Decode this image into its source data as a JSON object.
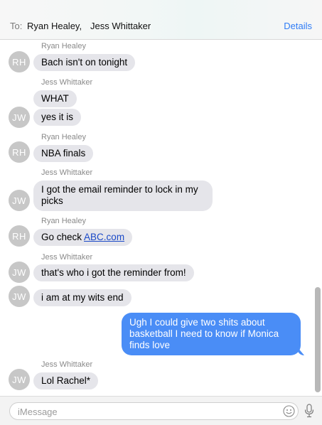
{
  "header": {
    "to_label": "To:",
    "recipients": [
      "Ryan Healey,",
      "Jess Whittaker"
    ],
    "details_label": "Details"
  },
  "thread": {
    "messages": [
      {
        "sender": "Ryan Healey",
        "avatar": "RH",
        "text": "Bach isn't on tonight"
      },
      {
        "sender": "Jess Whittaker",
        "text": "WHAT"
      },
      {
        "avatar": "JW",
        "text": "yes it is"
      },
      {
        "sender": "Ryan Healey",
        "avatar": "RH",
        "text": "NBA finals"
      },
      {
        "sender": "Jess Whittaker",
        "avatar": "JW",
        "text_line1": "I got the email reminder to lock in my",
        "text_line2": "picks"
      },
      {
        "sender": "Ryan Healey",
        "avatar": "RH",
        "text_prefix": "Go check ",
        "link": "ABC.com"
      },
      {
        "sender": "Jess Whittaker",
        "avatar": "JW",
        "text": "that's who i got the reminder from!"
      },
      {
        "avatar": "JW",
        "text": "i am at my wits end"
      },
      {
        "outgoing": true,
        "text_line1": "Ugh I could give two shits about",
        "text_line2": "basketball I need to know if Monica",
        "text_line3": "finds love"
      },
      {
        "sender": "Jess Whittaker",
        "avatar": "JW",
        "text": "Lol Rachel*"
      }
    ]
  },
  "input": {
    "placeholder": "iMessage",
    "icons": [
      "emoji-icon",
      "microphone-icon"
    ]
  },
  "colors": {
    "incoming_bubble": "#e5e5ea",
    "outgoing_bubble": "#4a8df6",
    "accent": "#2f7cf6",
    "avatar": "#c7c7c7"
  }
}
